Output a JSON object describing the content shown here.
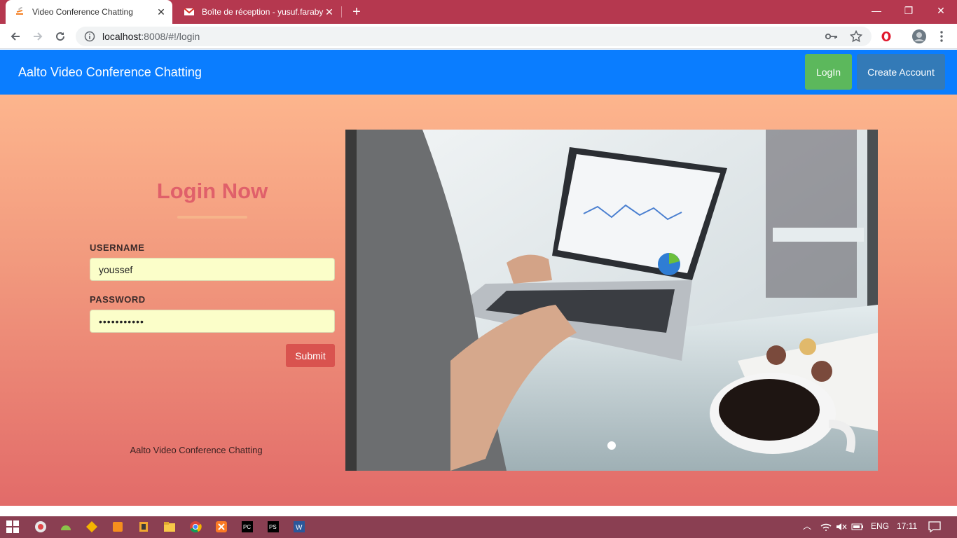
{
  "browser": {
    "tabs": [
      {
        "title": "Video Conference Chatting",
        "active": true
      },
      {
        "title": "Boîte de réception - yusuf.faraby",
        "active": false
      }
    ],
    "url_host": "localhost",
    "url_rest": ":8008/#!/login"
  },
  "appnav": {
    "brand": "Aalto Video Conference Chatting",
    "login_label": "LogIn",
    "create_label": "Create Account"
  },
  "login": {
    "title": "Login Now",
    "username_label": "USERNAME",
    "username_value": "youssef",
    "password_label": "PASSWORD",
    "password_value": "•••••••••••",
    "submit_label": "Submit",
    "footer": "Aalto Video Conference Chatting"
  },
  "taskbar": {
    "lang": "ENG",
    "time": "17:11"
  },
  "colors": {
    "tabstrip": "#b5384f",
    "appnav": "#0a7dff",
    "login_button": "#5cb85c",
    "create_button": "#337ab7",
    "submit_button": "#d9534f",
    "title_color": "#e0606a",
    "taskbar": "#8a3f52"
  }
}
